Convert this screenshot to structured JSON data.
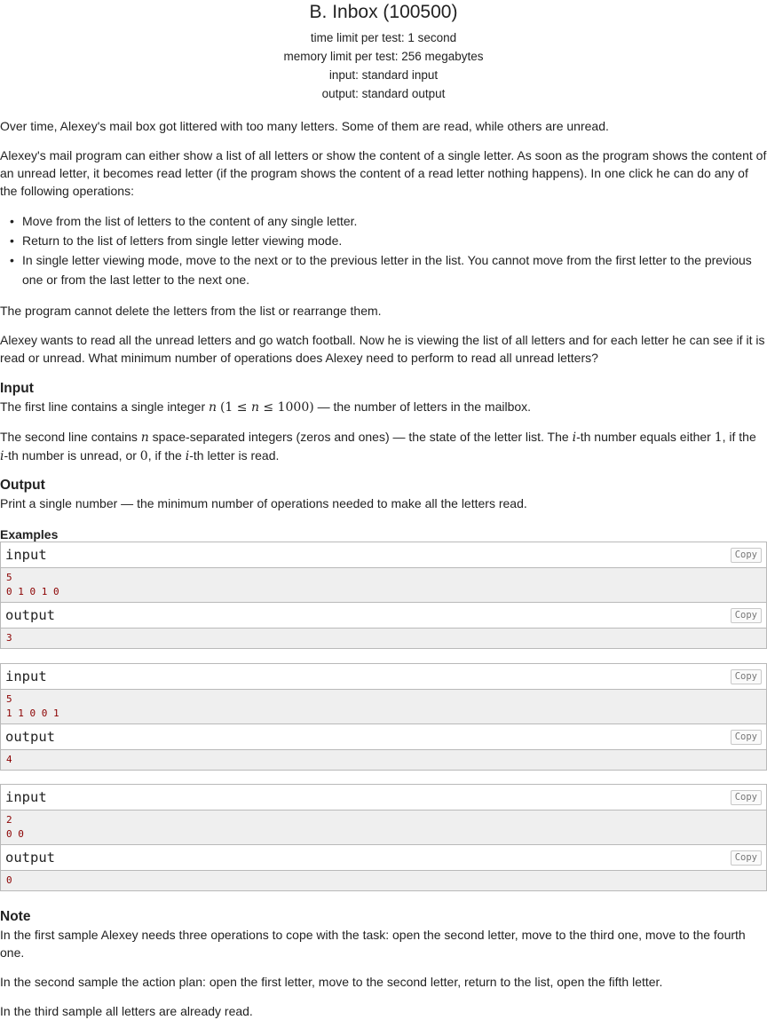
{
  "problem": {
    "title": "B. Inbox (100500)",
    "time_limit": "time limit per test: 1 second",
    "memory_limit": "memory limit per test: 256 megabytes",
    "input_file": "input: standard input",
    "output_file": "output: standard output"
  },
  "statement": {
    "p1": "Over time, Alexey's mail box got littered with too many letters. Some of them are read, while others are unread.",
    "p2": "Alexey's mail program can either show a list of all letters or show the content of a single letter. As soon as the program shows the content of an unread letter, it becomes read letter (if the program shows the content of a read letter nothing happens). In one click he can do any of the following operations:",
    "bullets": [
      "Move from the list of letters to the content of any single letter.",
      "Return to the list of letters from single letter viewing mode.",
      "In single letter viewing mode, move to the next or to the previous letter in the list. You cannot move from the first letter to the previous one or from the last letter to the next one."
    ],
    "p3": "The program cannot delete the letters from the list or rearrange them.",
    "p4": "Alexey wants to read all the unread letters and go watch football. Now he is viewing the list of all letters and for each letter he can see if it is read or unread. What minimum number of operations does Alexey need to perform to read all unread letters?"
  },
  "input_section": {
    "heading": "Input",
    "line1_a": "The first line contains a single integer ",
    "line1_n": "n",
    "line1_cond": "(1 ≤ ",
    "line1_cond_n": "n",
    "line1_cond_b": " ≤ 1000)",
    "line1_b": " — the number of letters in the mailbox.",
    "line2_a": "The second line contains ",
    "line2_n": "n",
    "line2_b": " space-separated integers (zeros and ones) — the state of the letter list. The ",
    "line2_i": "i",
    "line2_c": "-th number equals either ",
    "line2_one": "1",
    "line2_d": ", if the ",
    "line2_i2": "i",
    "line2_e": "-th number is unread, or ",
    "line2_zero": "0",
    "line2_f": ", if the ",
    "line2_i3": "i",
    "line2_g": "-th letter is read."
  },
  "output_section": {
    "heading": "Output",
    "text": "Print a single number — the minimum number of operations needed to make all the letters read."
  },
  "examples": {
    "heading": "Examples",
    "input_label": "input",
    "output_label": "output",
    "copy_label": "Copy",
    "tests": [
      {
        "input": "5\n0 1 0 1 0",
        "output": "3"
      },
      {
        "input": "5\n1 1 0 0 1",
        "output": "4"
      },
      {
        "input": "2\n0 0",
        "output": "0"
      }
    ]
  },
  "note": {
    "heading": "Note",
    "p1": "In the first sample Alexey needs three operations to cope with the task: open the second letter, move to the third one, move to the fourth one.",
    "p2": "In the second sample the action plan: open the first letter, move to the second letter, return to the list, open the fifth letter.",
    "p3": "In the third sample all letters are already read."
  }
}
